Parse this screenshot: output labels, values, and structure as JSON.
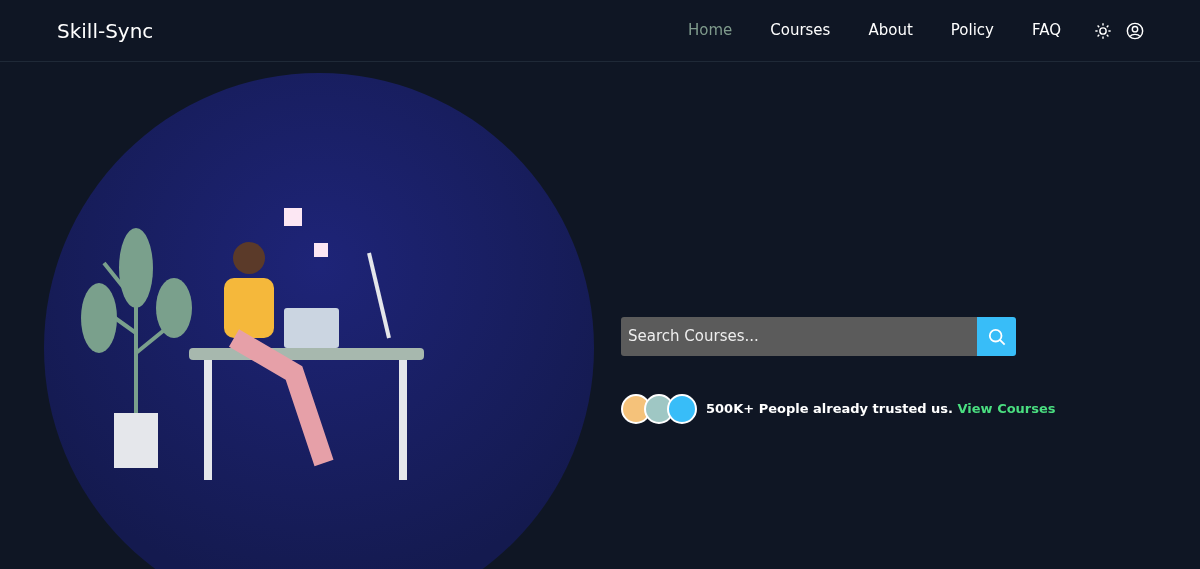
{
  "brand": "Skill-Sync",
  "nav": [
    {
      "label": "Home",
      "selected": true
    },
    {
      "label": "Courses",
      "selected": false
    },
    {
      "label": "About",
      "selected": false
    },
    {
      "label": "Policy",
      "selected": false
    },
    {
      "label": "FAQ",
      "selected": false
    }
  ],
  "search": {
    "placeholder": "Search Courses..."
  },
  "trust": {
    "avatars": [
      {
        "color": "#f5c27a"
      },
      {
        "color": "#9fc7c4"
      },
      {
        "color": "#38bdf8"
      }
    ],
    "text": "500K+ People already trusted us.",
    "link": "View Courses"
  }
}
